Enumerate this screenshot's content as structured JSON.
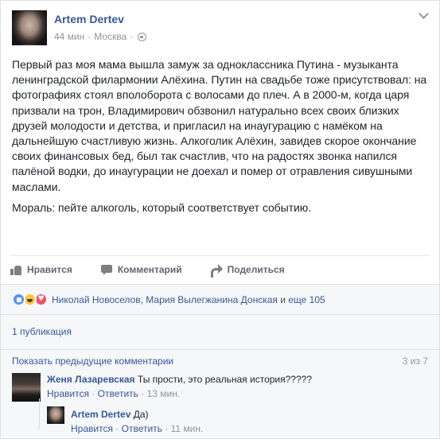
{
  "post": {
    "author": "Artem Dertev",
    "time": "44 мин",
    "separator": "·",
    "location": "Москва",
    "separator2": "·",
    "paragraph1": "Первый раз моя мама вышла замуж за одноклассника Путина - музыканта ленинградской филармонии Алёхина. Путин на свадьбе тоже присутствовал: на фотографиях стоял вполоборота с волосами до плеч. А в 2000-м, когда царя призвали на трон, Владимирович обзвонил натурально всех своих близких друзей молодости и детства, и пригласил на инаугурацию с намёком на дальнейшую счастливую жизнь. Алкоголик Алёхин, завидев скорое окончание своих финансовых бед, был так счастлив, что на радостях звонка напился палёной водки, до инаугурации не доехал и помер от отравления сивушными маслами.",
    "paragraph2": "Мораль: пейте алкоголь, который соответствует событию."
  },
  "actions": {
    "like": "Нравится",
    "comment": "Комментарий",
    "share": "Поделиться"
  },
  "reactions": {
    "name1": "Николай Новоселов",
    "comma": ", ",
    "name2": "Мария Вылегжанина Донская",
    "and": " и ",
    "more": "еще 105"
  },
  "shares": {
    "label": "1 публикация"
  },
  "comments": {
    "show_previous": "Показать предыдущие комментарии",
    "count": "3 из 7",
    "items": [
      {
        "name": "Женя Лазаревская",
        "text": "Ты прости, это реальная история?????",
        "like": "Нравится",
        "reply": "Ответить",
        "time": "13 мин."
      },
      {
        "name": "Artem Dertev",
        "text": "Да)",
        "like": "Нравится",
        "reply": "Ответить",
        "time": "11 мин."
      }
    ],
    "dot": "·"
  },
  "colors": {
    "link": "#365899",
    "meta": "#90949c",
    "text": "#1d2129",
    "background_light": "#f6f7f9"
  }
}
